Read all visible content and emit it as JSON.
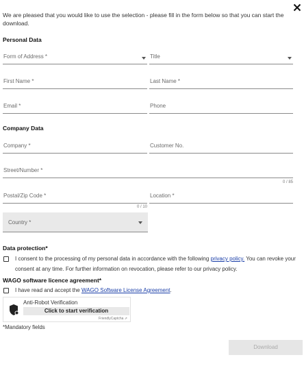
{
  "close_icon": "close-icon",
  "intro_text": "We are pleased that you would like to use the selection - please fill in the form below so that you can start the download.",
  "sections": {
    "personal": "Personal Data",
    "company": "Company Data",
    "data_protection": "Data protection*",
    "licence": "WAGO software licence agreement*"
  },
  "fields": {
    "form_of_address": "Form of Address *",
    "title": "Title",
    "first_name": "First Name *",
    "last_name": "Last Name *",
    "email": "Email *",
    "phone": "Phone",
    "company": "Company *",
    "customer_no": "Customer No.",
    "street": "Street/Number *",
    "street_counter": "0 / 85",
    "postal": "Postal/Zip Code *",
    "postal_counter": "0 / 10",
    "location": "Location *",
    "country": "Country *"
  },
  "consent": {
    "privacy_before": "I consent to the processing of my personal data in accordance with the following ",
    "privacy_link": "privacy policy.",
    "privacy_after": " You can revoke your consent at any time. For further information on revocation, please refer to our privacy policy.",
    "licence_before": "I have read and accept the ",
    "licence_link": "WAGO Software License Agreement",
    "licence_after": "."
  },
  "captcha": {
    "title": "Anti-Robot Verification",
    "button": "Click to start verification",
    "brand": "FriendlyCaptcha ⇗"
  },
  "mandatory_note": "*Mandatory fields",
  "download_label": "Download",
  "colors": {
    "link": "#1a3ea8",
    "country_bg": "#e9e9e9",
    "download_bg": "#e6e6e6",
    "download_text": "#aaaaaa"
  }
}
